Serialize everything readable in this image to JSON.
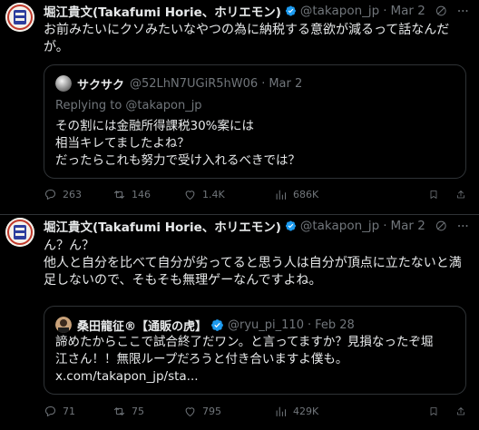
{
  "posts": [
    {
      "author": {
        "name": "堀江貴文(Takafumi Horie、ホリエモン)",
        "handle": "@takapon_jp",
        "time": "Mar 2"
      },
      "text_lines": [
        "お前みたいにクソみたいなやつの為に納税する意欲が減るって話なんだ",
        "が。"
      ],
      "quote": {
        "name": "サクサク",
        "handle": "@52LhN7UGiR5hW06",
        "time": "Mar 2",
        "replying": "Replying to @takapon_jp",
        "text_lines": [
          "その割には金融所得課税30%案には",
          "相当キレてましたよね？",
          "だったらこれも努力で受け入れるべきでは？"
        ]
      },
      "stats": {
        "replies": "263",
        "reposts": "146",
        "likes": "1.4K",
        "views": "686K"
      }
    },
    {
      "author": {
        "name": "堀江貴文(Takafumi Horie、ホリエモン)",
        "handle": "@takapon_jp",
        "time": "Mar 2"
      },
      "text_lines": [
        "ん？ん？",
        "他人と自分を比べて自分が劣ってると思う人は自分が頂点に立たないと満",
        "足しないので、そもそも無理ゲーなんですよね。"
      ],
      "quote": {
        "name": "桑田龍征®︎【通販の虎】",
        "handle": "@ryu_pi_110",
        "time": "Feb 28",
        "text_lines": [
          "諦めたからここで試合終了だワン。と言ってますか？見損なったぞ堀",
          "江さん！！無限ループだろうと付き合いますよ僕も。",
          "x.com/takapon_jp/sta..."
        ]
      },
      "stats": {
        "replies": "71",
        "reposts": "75",
        "likes": "795",
        "views": "429K"
      }
    }
  ],
  "colors": {
    "background": "#000000",
    "text": "#e7e9ea",
    "muted": "#71767b",
    "border": "#2f3336",
    "verified": "#1d9bf0"
  }
}
